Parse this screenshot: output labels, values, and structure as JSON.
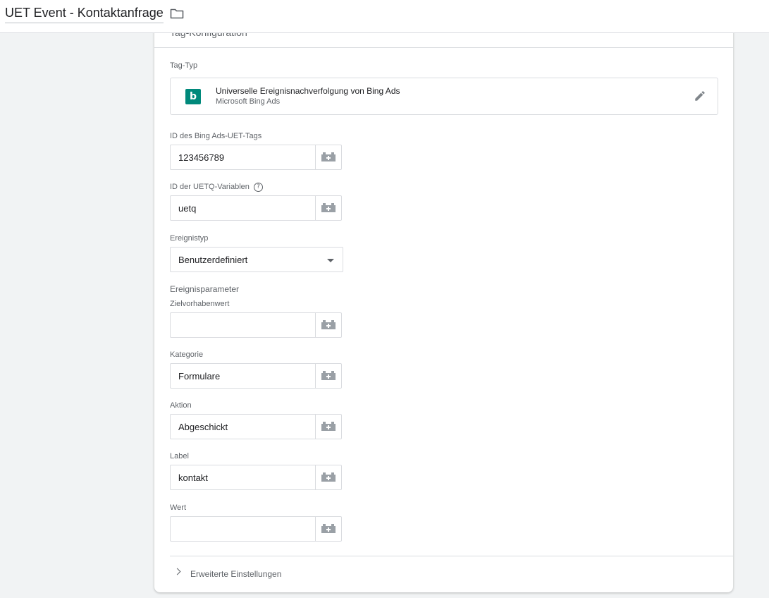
{
  "header": {
    "title": "UET Event - Kontaktanfrage",
    "folder_icon": "folder-icon"
  },
  "card": {
    "header_label": "Tag-Konfiguration",
    "tag_type": {
      "label": "Tag-Typ",
      "name": "Universelle Ereignisnachverfolgung von Bing Ads",
      "vendor": "Microsoft Bing Ads",
      "logo_letter": "b",
      "logo_color": "#00897b",
      "edit_icon": "pencil-icon"
    },
    "fields": {
      "uet_tag_id": {
        "label": "ID des Bing Ads-UET-Tags",
        "value": "123456789"
      },
      "uetq_var": {
        "label": "ID der UETQ-Variablen",
        "value": "uetq",
        "help_icon": "?"
      },
      "event_type": {
        "label": "Ereignistyp",
        "value": "Benutzerdefiniert"
      },
      "params_section": "Ereignisparameter",
      "goal_value": {
        "label": "Zielvorhabenwert",
        "value": ""
      },
      "category": {
        "label": "Kategorie",
        "value": "Formulare"
      },
      "action": {
        "label": "Aktion",
        "value": "Abgeschickt"
      },
      "event_label": {
        "label": "Label",
        "value": "kontakt"
      },
      "value": {
        "label": "Wert",
        "value": ""
      }
    },
    "advanced": {
      "label": "Erweiterte Einstellungen"
    }
  },
  "colors": {
    "accent": "#00897b",
    "background": "#f1f3f4",
    "border": "#dadce0",
    "text_secondary": "#5f6368"
  }
}
